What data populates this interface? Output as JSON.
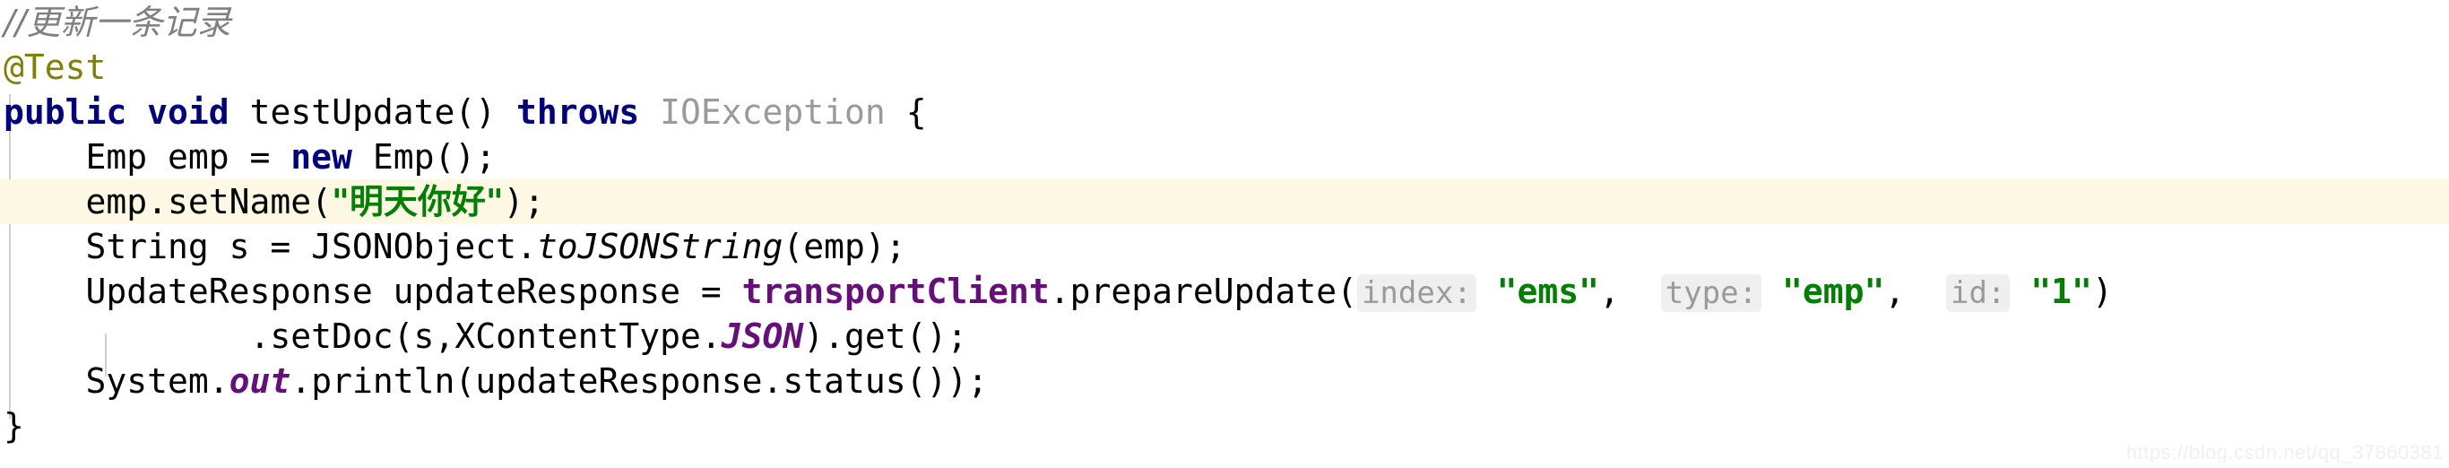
{
  "editor": {
    "language": "Java",
    "highlighted_line_index": 4,
    "colors": {
      "background": "#ffffff",
      "highlight_background": "#fdf8e3",
      "comment": "#808080",
      "annotation": "#808000",
      "keyword": "#000080",
      "string": "#008000",
      "static_field": "#660e7a",
      "grayed_class": "#9a9a9a",
      "param_hint_text": "#9a9a9a",
      "param_hint_background": "#efefef",
      "indent_guide": "#cfcfcf",
      "watermark": "#f0f0f0"
    },
    "lines": [
      {
        "index": 0,
        "indent": "",
        "tokens": [
          {
            "kind": "comment",
            "text": "//更新一条记录"
          }
        ]
      },
      {
        "index": 1,
        "indent": "",
        "tokens": [
          {
            "kind": "annotation",
            "text": "@Test"
          }
        ]
      },
      {
        "index": 2,
        "indent": "",
        "tokens": [
          {
            "kind": "keyword",
            "text": "public"
          },
          {
            "kind": "plain",
            "text": " "
          },
          {
            "kind": "keyword",
            "text": "void"
          },
          {
            "kind": "plain",
            "text": " testUpdate() "
          },
          {
            "kind": "keyword",
            "text": "throws"
          },
          {
            "kind": "plain",
            "text": " "
          },
          {
            "kind": "grayed",
            "text": "IOException"
          },
          {
            "kind": "plain",
            "text": " {"
          }
        ]
      },
      {
        "index": 3,
        "indent": "    ",
        "tokens": [
          {
            "kind": "plain",
            "text": "    Emp emp = "
          },
          {
            "kind": "keyword",
            "text": "new"
          },
          {
            "kind": "plain",
            "text": " Emp();"
          }
        ]
      },
      {
        "index": 4,
        "indent": "    ",
        "tokens": [
          {
            "kind": "plain",
            "text": "    emp.setName("
          },
          {
            "kind": "string",
            "text": "\"明天你好\""
          },
          {
            "kind": "plain",
            "text": ");"
          }
        ]
      },
      {
        "index": 5,
        "indent": "    ",
        "tokens": [
          {
            "kind": "plain",
            "text": "    String s = JSONObject."
          },
          {
            "kind": "italic",
            "text": "toJSONString"
          },
          {
            "kind": "plain",
            "text": "(emp);"
          }
        ]
      },
      {
        "index": 6,
        "indent": "    ",
        "tokens": [
          {
            "kind": "plain",
            "text": "    UpdateResponse updateResponse = "
          },
          {
            "kind": "static",
            "text": "transportClient"
          },
          {
            "kind": "plain",
            "text": ".prepareUpdate("
          },
          {
            "kind": "hint",
            "text": "index:"
          },
          {
            "kind": "plain",
            "text": " "
          },
          {
            "kind": "string",
            "text": "\"ems\""
          },
          {
            "kind": "plain",
            "text": ",  "
          },
          {
            "kind": "hint",
            "text": "type:"
          },
          {
            "kind": "plain",
            "text": " "
          },
          {
            "kind": "string",
            "text": "\"emp\""
          },
          {
            "kind": "plain",
            "text": ",  "
          },
          {
            "kind": "hint",
            "text": "id:"
          },
          {
            "kind": "plain",
            "text": " "
          },
          {
            "kind": "string",
            "text": "\"1\""
          },
          {
            "kind": "plain",
            "text": ")"
          }
        ]
      },
      {
        "index": 7,
        "indent": "            ",
        "tokens": [
          {
            "kind": "plain",
            "text": "            .setDoc(s,XContentType."
          },
          {
            "kind": "field",
            "text": "JSON"
          },
          {
            "kind": "plain",
            "text": ").get();"
          }
        ]
      },
      {
        "index": 8,
        "indent": "    ",
        "tokens": [
          {
            "kind": "plain",
            "text": "    System."
          },
          {
            "kind": "field",
            "text": "out"
          },
          {
            "kind": "plain",
            "text": ".println(updateResponse.status());"
          }
        ]
      },
      {
        "index": 9,
        "indent": "",
        "tokens": [
          {
            "kind": "plain",
            "text": "}"
          }
        ]
      }
    ],
    "parameter_hints": [
      {
        "label": "index:",
        "value": "\"ems\""
      },
      {
        "label": "type:",
        "value": "\"emp\""
      },
      {
        "label": "id:",
        "value": "\"1\""
      }
    ]
  },
  "watermark": {
    "text": "https://blog.csdn.net/qq_37860381"
  }
}
